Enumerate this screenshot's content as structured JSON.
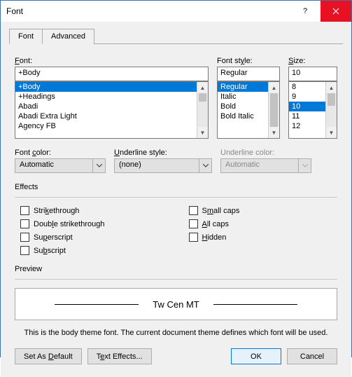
{
  "title": "Font",
  "tabs": {
    "font": "Font",
    "advanced": "Advanced"
  },
  "labels": {
    "font": "Font:",
    "fontstyle": "Font style:",
    "size": "Size:",
    "fontcolor": "Font color:",
    "underlinestyle": "Underline style:",
    "underlinecolor": "Underline color:",
    "effects": "Effects",
    "preview": "Preview"
  },
  "values": {
    "font": "+Body",
    "fontstyle": "Regular",
    "size": "10",
    "fontcolor": "Automatic",
    "underlinestyle": "(none)",
    "underlinecolor": "Automatic"
  },
  "lists": {
    "fonts": [
      "+Body",
      "+Headings",
      "Abadi",
      "Abadi Extra Light",
      "Agency FB"
    ],
    "styles": [
      "Regular",
      "Italic",
      "Bold",
      "Bold Italic"
    ],
    "sizes": [
      "8",
      "9",
      "10",
      "11",
      "12"
    ]
  },
  "effects": {
    "strike": "Strikethrough",
    "dstrike": "Double strikethrough",
    "super": "Superscript",
    "sub": "Subscript",
    "smallcaps": "Small caps",
    "allcaps": "All caps",
    "hidden": "Hidden"
  },
  "preview": {
    "sample": "Tw Cen MT",
    "hint": "This is the body theme font. The current document theme defines which font will be used."
  },
  "buttons": {
    "setdefault": "Set As Default",
    "texteffects": "Text Effects...",
    "ok": "OK",
    "cancel": "Cancel"
  }
}
